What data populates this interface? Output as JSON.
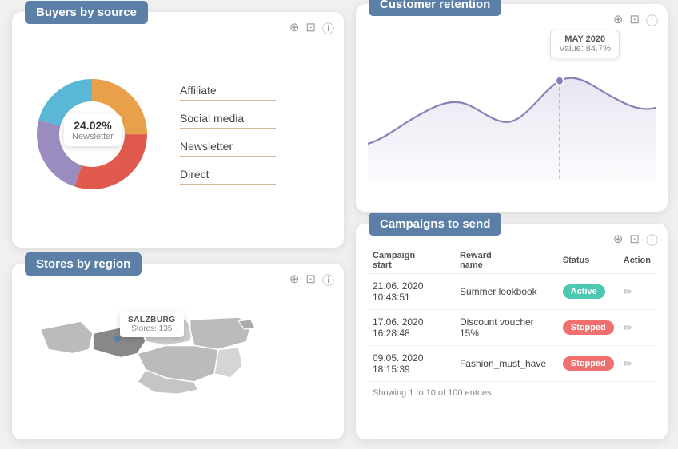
{
  "buyers_card": {
    "title": "Buyers by source",
    "tooltip": {
      "percent": "24.02%",
      "label": "Newsletter"
    },
    "legend": [
      {
        "label": "Affiliate",
        "color": "#e8a04a"
      },
      {
        "label": "Social media",
        "color": "#e05a4e"
      },
      {
        "label": "Newsletter",
        "color": "#9b8cbf"
      },
      {
        "label": "Direct",
        "color": "#5ab8d6"
      }
    ],
    "donut": {
      "segments": [
        {
          "label": "Affiliate",
          "value": 25,
          "color": "#e8a04a"
        },
        {
          "label": "Social media",
          "value": 30,
          "color": "#e05a4e"
        },
        {
          "label": "Newsletter",
          "value": 24,
          "color": "#9b8cbf"
        },
        {
          "label": "Direct",
          "value": 21,
          "color": "#5ab8d6"
        }
      ]
    },
    "icons": [
      "+",
      "⊡",
      "ℹ"
    ]
  },
  "retention_card": {
    "title": "Customer retention",
    "tooltip": {
      "date": "MAY 2020",
      "value": "Value: 84.7%"
    },
    "icons": [
      "+",
      "⊡",
      "ℹ"
    ]
  },
  "stores_card": {
    "title": "Stores by region",
    "map_tooltip": {
      "region": "SALZBURG",
      "stores": "Stores: 135"
    },
    "icons": [
      "+",
      "⊡",
      "ℹ"
    ]
  },
  "campaigns_card": {
    "title": "Campaigns to send",
    "icons": [
      "+",
      "⊡",
      "ℹ"
    ],
    "table": {
      "headers": [
        "Campaign start",
        "Reward name",
        "Status",
        "Action"
      ],
      "rows": [
        {
          "date": "21.06. 2020 10:43:51",
          "reward": "Summer lookbook",
          "status": "Active",
          "status_type": "active"
        },
        {
          "date": "17.06. 2020 16:28:48",
          "reward": "Discount voucher 15%",
          "status": "Stopped",
          "status_type": "stopped"
        },
        {
          "date": "09.05. 2020 18:15:39",
          "reward": "Fashion_must_have",
          "status": "Stopped",
          "status_type": "stopped"
        }
      ],
      "footer": "Showing 1 to 10 of 100 entries"
    }
  }
}
